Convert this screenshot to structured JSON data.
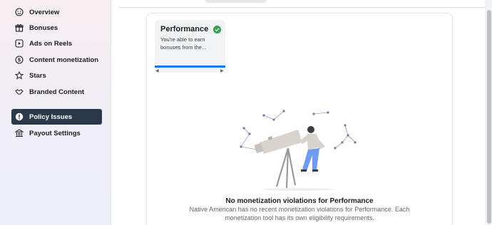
{
  "sidebar": {
    "items": [
      {
        "label": "Overview",
        "icon": "smiley-face-icon",
        "active": false
      },
      {
        "label": "Bonuses",
        "icon": "gift-icon",
        "active": false
      },
      {
        "label": "Ads on Reels",
        "icon": "reels-icon",
        "active": false
      },
      {
        "label": "Content monetization",
        "icon": "dollar-circle-icon",
        "active": false
      },
      {
        "label": "Stars",
        "icon": "star-icon",
        "active": false
      },
      {
        "label": "Branded Content",
        "icon": "handshake-icon",
        "active": false
      },
      {
        "label": "Policy Issues",
        "icon": "alert-circle-icon",
        "active": true
      },
      {
        "label": "Payout Settings",
        "icon": "bank-icon",
        "active": false
      }
    ]
  },
  "tool_tile": {
    "title": "Performance",
    "description": "You're able to earn bonuses from the...",
    "status_icon": "check-circle-icon",
    "status_color": "#31a24c",
    "left_arrow": "◀",
    "right_arrow": "▶"
  },
  "empty_state": {
    "title": "No monetization violations for Performance",
    "description": "Native American has no recent monetization violations for Performance. Each monetization tool has its own eligibility requirements."
  },
  "colors": {
    "accent": "#1877f2",
    "active_nav": "#2b3a4a"
  }
}
